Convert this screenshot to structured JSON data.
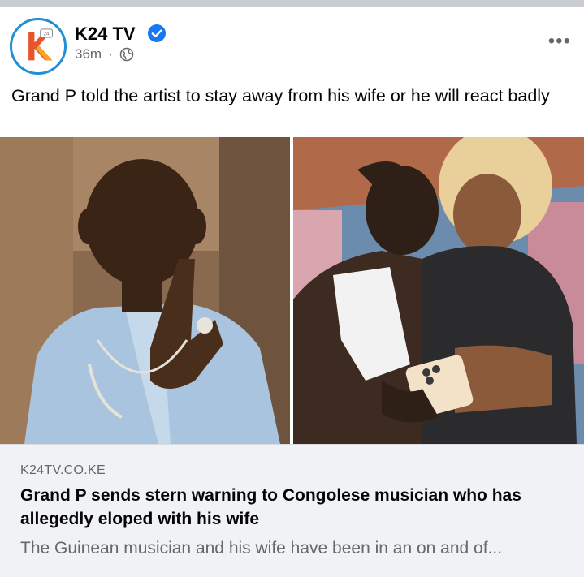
{
  "post": {
    "page_name": "K24 TV",
    "time": "36m",
    "separator": "·",
    "privacy_icon": "globe-icon",
    "verified_icon": "verified-badge-icon",
    "more_icon": "more-options-icon",
    "more_label": "•••",
    "caption": "Grand P told the artist to stay away from his wife or he will react badly"
  },
  "link_preview": {
    "domain": "K24TV.CO.KE",
    "title": "Grand P sends stern warning to Congolese musician who has allegedly eloped with his wife",
    "description": "The Guinean musician and his wife have been in an on and of..."
  },
  "colors": {
    "brand_blue": "#1877f2",
    "avatar_ring": "#1f8fd6",
    "secondary_text": "#65676b",
    "link_bg": "#f0f2f5"
  }
}
